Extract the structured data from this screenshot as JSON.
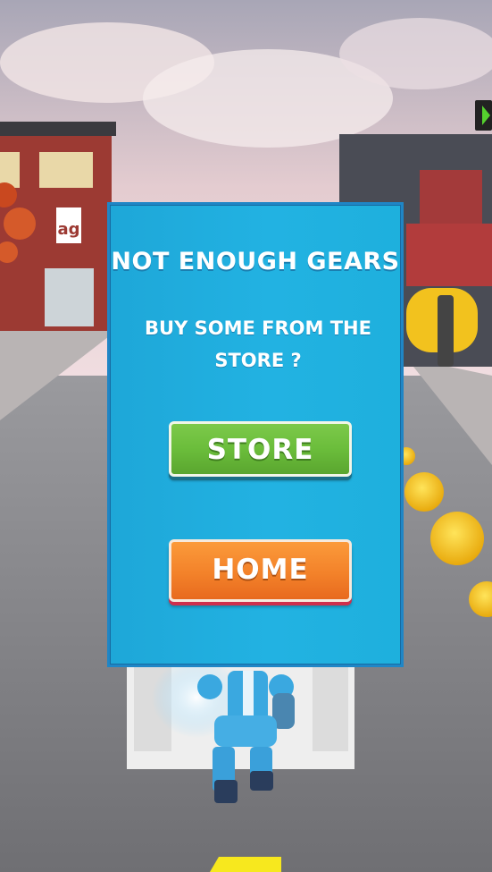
{
  "dialog": {
    "title": "NOT ENOUGH GEARS",
    "message": "BUY SOME FROM THE STORE ?",
    "store_label": "STORE",
    "home_label": "HOME"
  },
  "colors": {
    "panel": "#22b2e2",
    "panel_border": "#1f86c6",
    "store_button": "#6bbd3b",
    "home_button": "#f3822a"
  }
}
